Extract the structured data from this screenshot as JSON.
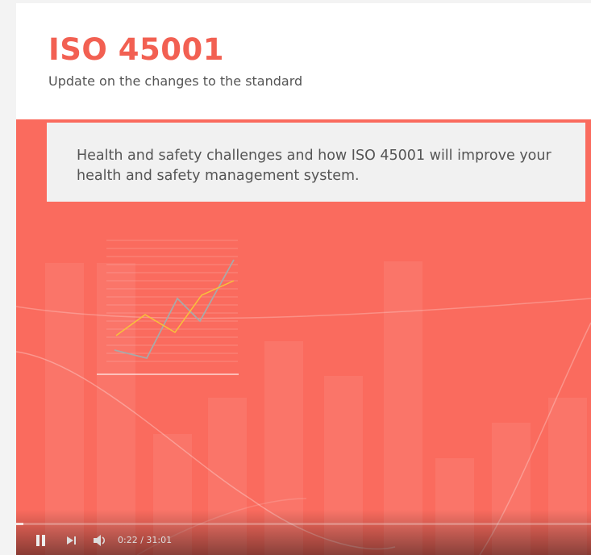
{
  "slide": {
    "title": "ISO 45001",
    "subtitle": "Update on the changes to the standard",
    "card_text": "Health and safety challenges and how ISO 45001 will improve your health and safety management system."
  },
  "player": {
    "current_time": "0:22",
    "separator": " / ",
    "duration": "31:01",
    "progress_fraction": 0.012,
    "controls": [
      "pause-icon",
      "next-icon",
      "volume-icon"
    ]
  },
  "colors": {
    "accent": "#f26052",
    "slide_background": "#fa6b5e",
    "card_background": "#f1f1f1",
    "text_gray": "#555555",
    "line_yellow": "#f7c23b",
    "line_gray": "#a9a9a9"
  }
}
